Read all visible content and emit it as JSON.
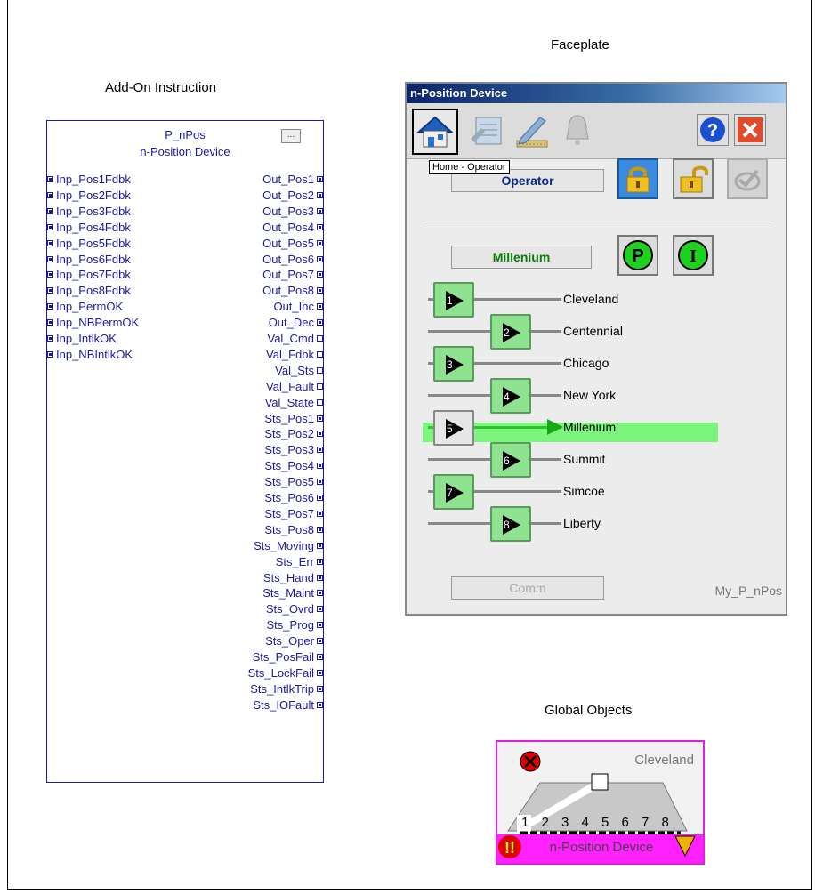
{
  "titles": {
    "faceplate": "Faceplate",
    "aoi": "Add-On Instruction",
    "global": "Global Objects"
  },
  "aoi": {
    "name": "P_nPos",
    "description": "n-Position Device",
    "config_button": "...",
    "inputs": [
      "Inp_Pos1Fdbk",
      "Inp_Pos2Fdbk",
      "Inp_Pos3Fdbk",
      "Inp_Pos4Fdbk",
      "Inp_Pos5Fdbk",
      "Inp_Pos6Fdbk",
      "Inp_Pos7Fdbk",
      "Inp_Pos8Fdbk",
      "Inp_PermOK",
      "Inp_NBPermOK",
      "Inp_IntlkOK",
      "Inp_NBIntlkOK"
    ],
    "outputs": [
      "Out_Pos1",
      "Out_Pos2",
      "Out_Pos3",
      "Out_Pos4",
      "Out_Pos5",
      "Out_Pos6",
      "Out_Pos7",
      "Out_Pos8",
      "Out_Inc",
      "Out_Dec",
      "Val_Cmd",
      "Val_Fdbk",
      "Val_Sts",
      "Val_Fault",
      "Val_State",
      "Sts_Pos1",
      "Sts_Pos2",
      "Sts_Pos3",
      "Sts_Pos4",
      "Sts_Pos5",
      "Sts_Pos6",
      "Sts_Pos7",
      "Sts_Pos8",
      "Sts_Moving",
      "Sts_Err",
      "Sts_Hand",
      "Sts_Maint",
      "Sts_Ovrd",
      "Sts_Prog",
      "Sts_Oper",
      "Sts_PosFail",
      "Sts_LockFail",
      "Sts_IntlkTrip",
      "Sts_IOFault"
    ]
  },
  "faceplate": {
    "window_title": "n-Position Device",
    "tooltip": "Home - Operator",
    "mode": "Operator",
    "current_position": "Millenium",
    "btn_p": "P",
    "btn_i": "I",
    "positions": [
      {
        "num": "1",
        "label": "Cleveland"
      },
      {
        "num": "2",
        "label": "Centennial"
      },
      {
        "num": "3",
        "label": "Chicago"
      },
      {
        "num": "4",
        "label": "New York"
      },
      {
        "num": "5",
        "label": "Millenium"
      },
      {
        "num": "6",
        "label": "Summit"
      },
      {
        "num": "7",
        "label": "Simcoe"
      },
      {
        "num": "8",
        "label": "Liberty"
      }
    ],
    "comm": "Comm",
    "tag": "My_P_nPos",
    "colors": {
      "active": "#7cf57c",
      "button": "#8fe28f",
      "title_bar": "#0a246a"
    }
  },
  "global_object": {
    "position": "Cleveland",
    "numbers": [
      "1",
      "2",
      "3",
      "4",
      "5",
      "6",
      "7",
      "8"
    ],
    "label": "n-Position Device",
    "colors": {
      "border": "#e020e0",
      "label_bg": "#ff20ff"
    }
  }
}
